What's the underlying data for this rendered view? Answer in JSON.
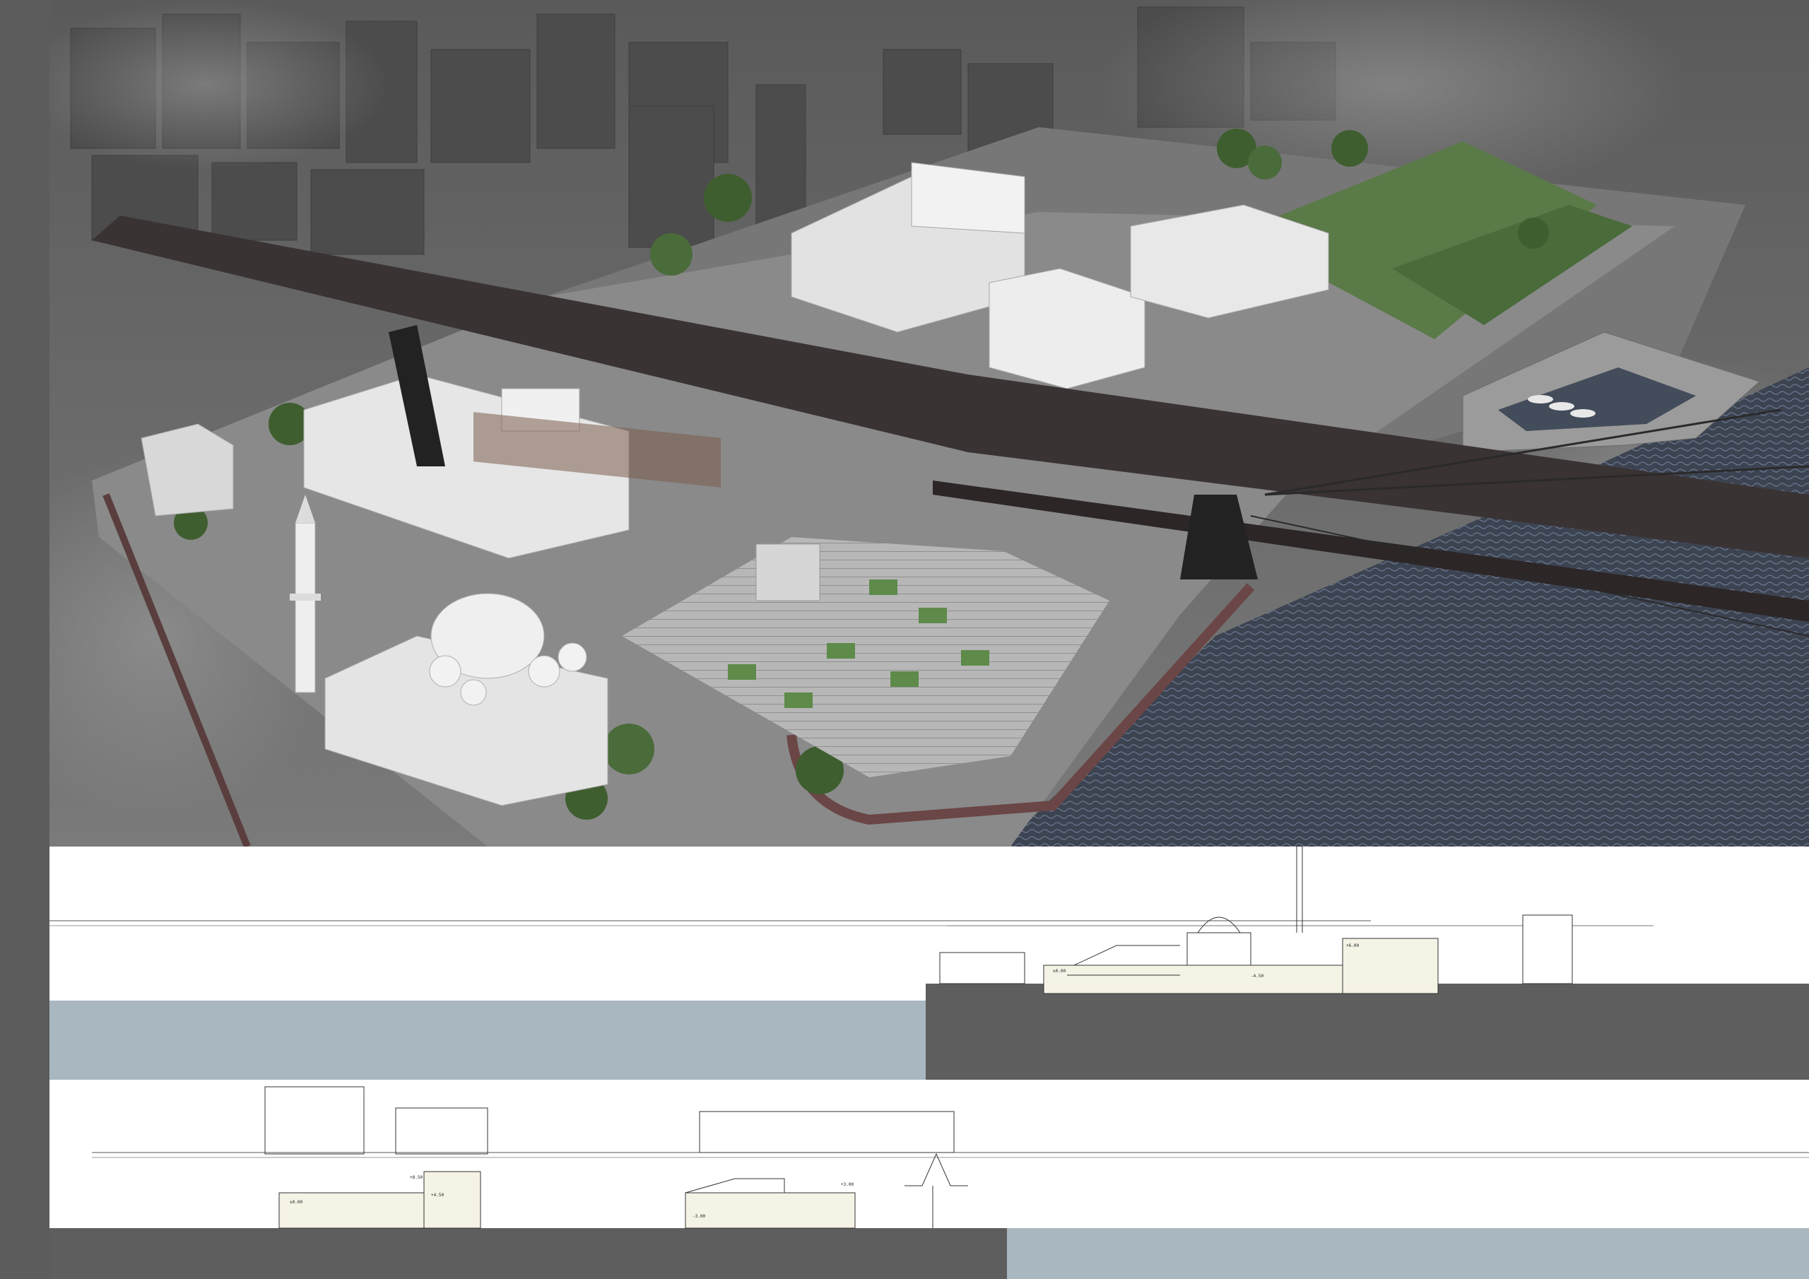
{
  "sheet": {
    "colors": {
      "sidebar": "#5c5c5c",
      "water_render": "#3c4452",
      "section_water": "#a9b7c0",
      "section_ground": "#5e5e5e",
      "bridge": "#3a3333",
      "landscape_green": "#4a6b3a",
      "buildings": "#e6e6e6"
    }
  },
  "render": {
    "elements": [
      "surrounding-city-blocks",
      "bridge",
      "mosque",
      "minaret",
      "cultural-center",
      "theatre-block",
      "terraced-plaza",
      "gardens",
      "pier",
      "marina",
      "water"
    ]
  },
  "sections": {
    "top": {
      "level_labels": [
        "±0.00",
        "-4.50",
        "+6.00"
      ]
    },
    "bottom": {
      "level_labels": [
        "+8.50",
        "+4.50",
        "±0.00",
        "-3.00",
        "+3.00"
      ]
    }
  }
}
